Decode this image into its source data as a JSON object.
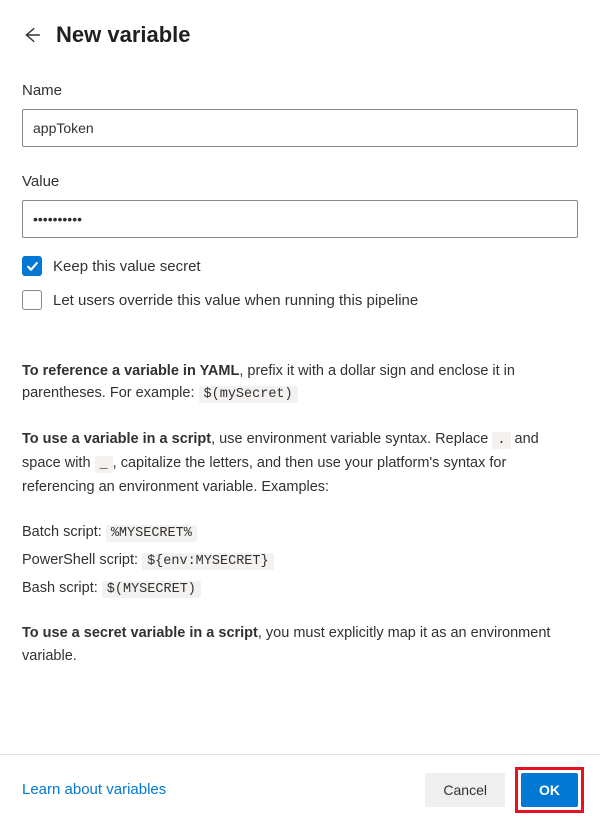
{
  "header": {
    "title": "New variable"
  },
  "fields": {
    "name": {
      "label": "Name",
      "value": "appToken"
    },
    "value": {
      "label": "Value",
      "value": "••••••••••"
    }
  },
  "checkboxes": {
    "keep_secret": {
      "label": "Keep this value secret",
      "checked": true
    },
    "allow_override": {
      "label": "Let users override this value when running this pipeline",
      "checked": false
    }
  },
  "info": {
    "yaml_ref_bold": "To reference a variable in YAML",
    "yaml_ref_rest": ", prefix it with a dollar sign and enclose it in parentheses. For example: ",
    "yaml_ref_code": "$(mySecret)",
    "script_use_bold": "To use a variable in a script",
    "script_use_1": ", use environment variable syntax. Replace ",
    "script_use_dot": ".",
    "script_use_2": " and space with ",
    "script_use_us": "_",
    "script_use_3": ", capitalize the letters, and then use your platform's syntax for referencing an environment variable. Examples:",
    "batch_label": "Batch script: ",
    "batch_code": "%MYSECRET%",
    "ps_label": "PowerShell script: ",
    "ps_code": "${env:MYSECRET}",
    "bash_label": "Bash script: ",
    "bash_code": "$(MYSECRET)",
    "secret_bold": "To use a secret variable in a script",
    "secret_rest": ", you must explicitly map it as an environment variable."
  },
  "footer": {
    "learn_link": "Learn about variables",
    "cancel": "Cancel",
    "ok": "OK"
  }
}
